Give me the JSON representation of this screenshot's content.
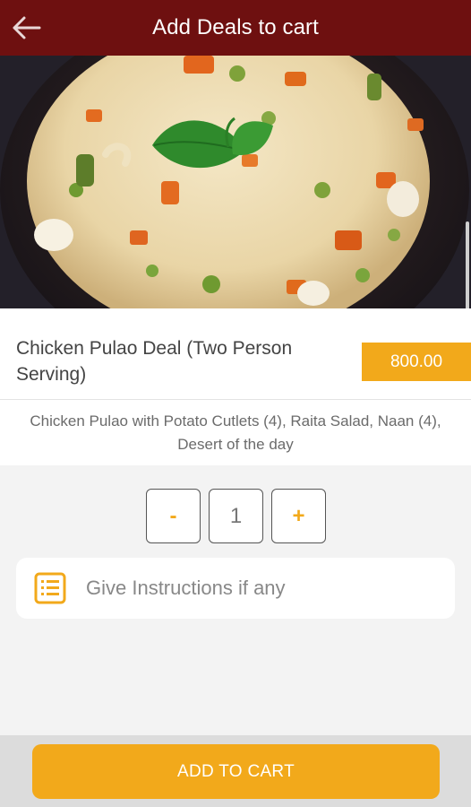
{
  "header": {
    "title": "Add Deals to cart",
    "back_icon": "arrow-left-icon",
    "background": "#6e1010"
  },
  "hero_image": {
    "description_icon": "food-photo"
  },
  "deal": {
    "name": "Chicken Pulao Deal (Two Person Serving)",
    "price": "800.00",
    "description": "Chicken Pulao with Potato Cutlets (4), Raita Salad, Naan (4), Desert of the day"
  },
  "quantity": {
    "decrement_label": "-",
    "value": "1",
    "increment_label": "+"
  },
  "instructions": {
    "placeholder": "Give Instructions if any",
    "icon": "list-note-icon"
  },
  "actions": {
    "add_to_cart_label": "ADD TO CART"
  },
  "colors": {
    "accent": "#f2a91b",
    "header": "#6e1010",
    "background": "#f3f3f3"
  }
}
